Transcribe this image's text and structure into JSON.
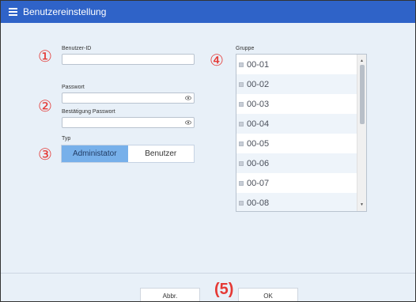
{
  "window": {
    "title": "Benutzereinstellung"
  },
  "form": {
    "user_id_label": "Benutzer-ID",
    "user_id_value": "",
    "password_label": "Passwort",
    "password_value": "",
    "confirm_password_label": "Bestätigung Passwort",
    "confirm_password_value": "",
    "type_label": "Typ",
    "type_options": [
      "Administator",
      "Benutzer"
    ],
    "type_selected": "Administator"
  },
  "group": {
    "label": "Gruppe",
    "items": [
      "00-01",
      "00-02",
      "00-03",
      "00-04",
      "00-05",
      "00-06",
      "00-07",
      "00-08"
    ]
  },
  "markers": [
    "①",
    "②",
    "③",
    "④",
    "(5)"
  ],
  "footer": {
    "cancel_label": "Abbr.",
    "ok_label": "OK"
  },
  "colors": {
    "titlebar": "#2f63c8",
    "selected_segment": "#77b0ea",
    "marker": "#e53935"
  }
}
